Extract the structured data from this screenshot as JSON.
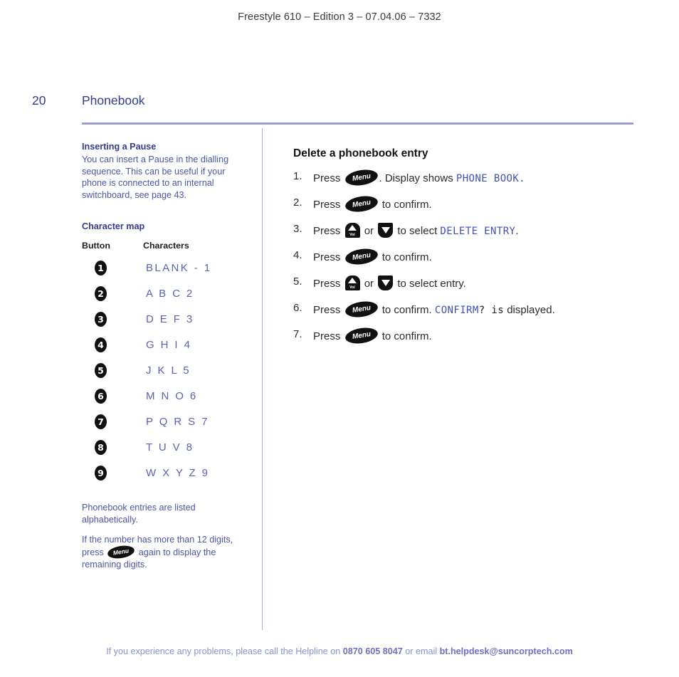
{
  "running_head": "Freestyle 610 – Edition 3 – 07.04.06 – 7332",
  "page": {
    "folio": "20",
    "chapter_title": "Phonebook"
  },
  "left_column": {
    "pause_heading": "Inserting a Pause",
    "pause_body": "You can insert a Pause in the dialling sequence. This can be useful if your phone is connected to an internal switchboard, see page 43.",
    "charmap_heading": "Character map",
    "charmap_columns": [
      "Button",
      "Characters"
    ],
    "charmap_rows": [
      {
        "button": "1",
        "characters": "BLANK - 1"
      },
      {
        "button": "2",
        "characters": "A B C 2"
      },
      {
        "button": "3",
        "characters": "D E F 3"
      },
      {
        "button": "4",
        "characters": "G H I 4"
      },
      {
        "button": "5",
        "characters": "J K L 5"
      },
      {
        "button": "6",
        "characters": "M N O 6"
      },
      {
        "button": "7",
        "characters": "P Q R S 7"
      },
      {
        "button": "8",
        "characters": "T U V 8"
      },
      {
        "button": "9",
        "characters": "W X Y Z 9"
      }
    ],
    "note_alphabetical": "Phonebook entries are listed alphabetically.",
    "note_digits_1": "If the number has more than 12 digits, press",
    "note_digits_key": "Menu",
    "note_digits_2": "again to display the remaining digits."
  },
  "right_column": {
    "section_title": "Delete a phonebook entry",
    "steps": [
      {
        "num": "1.",
        "press": "Press",
        "key": "Menu",
        "after": ". Display shows",
        "lcd": "PHONE BOOK.",
        "tail": ""
      },
      {
        "num": "2.",
        "press": "Press",
        "key": "Menu",
        "after": "to confirm.",
        "lcd": "",
        "tail": ""
      },
      {
        "num": "3.",
        "press": "Press",
        "key_up": "Vol",
        "or": "or",
        "key_down": "down",
        "after": "to select",
        "lcd": "DELETE ENTRY",
        "tail": "."
      },
      {
        "num": "4.",
        "press": "Press",
        "key": "Menu",
        "after": "to confirm.",
        "lcd": "",
        "tail": ""
      },
      {
        "num": "5.",
        "press": "Press",
        "key_up": "Vol",
        "or": "or",
        "key_down": "down",
        "after": "to select entry.",
        "lcd": "",
        "tail": ""
      },
      {
        "num": "6.",
        "press": "Press",
        "key": "Menu",
        "after": "to confirm.",
        "lcd": "CONFIRM",
        "lcd_dark": "? is",
        "tail": "displayed."
      },
      {
        "num": "7.",
        "press": "Press",
        "key": "Menu",
        "after": "to confirm.",
        "lcd": "",
        "tail": ""
      }
    ]
  },
  "footer": {
    "lead": "If you experience any problems, please call the Helpline on",
    "phone": "0870 605 8047",
    "middle": "or email",
    "email": "bt.helpdesk@suncorptech.com"
  },
  "colors": {
    "title_blue": "#2f3d91",
    "body_blue": "#4a55a8",
    "charmap_blue": "#5a63b0",
    "lcd_blue": "#3f52b5",
    "rule": "#9a9fd0",
    "footer": "#8a90cf"
  }
}
